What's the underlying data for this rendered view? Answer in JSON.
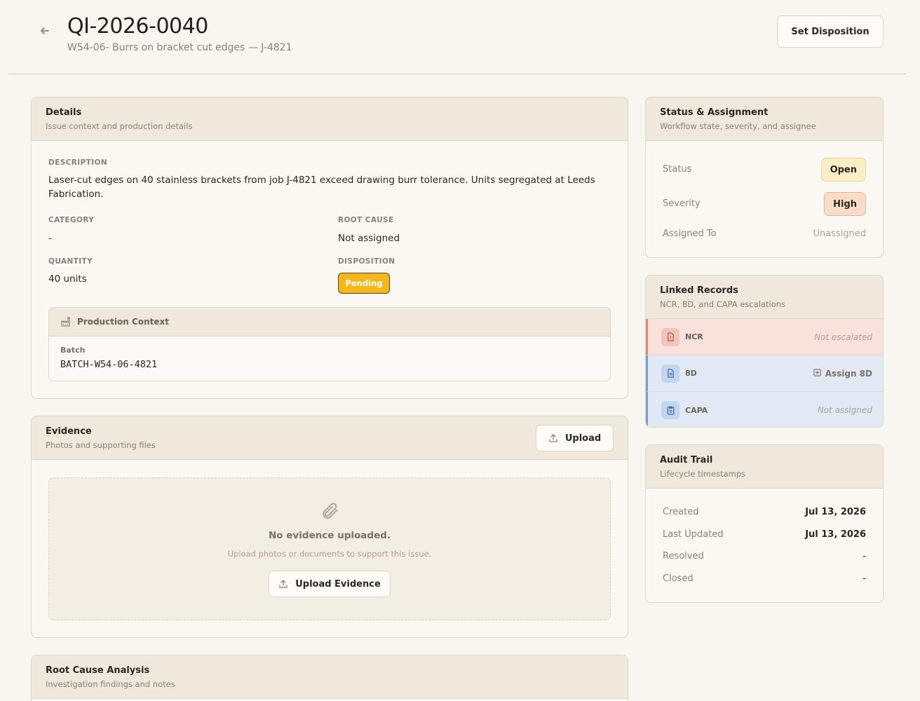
{
  "header": {
    "title": "QI-2026-0040",
    "subtitle": "W54-06- Burrs on bracket cut edges — J-4821",
    "set_disposition_label": "Set Disposition"
  },
  "details": {
    "title": "Details",
    "subtitle": "Issue context and production details",
    "description_label": "Description",
    "description": "Laser-cut edges on 40 stainless brackets from job J-4821 exceed drawing burr tolerance. Units segregated at Leeds Fabrication.",
    "category_label": "Category",
    "category": "-",
    "root_cause_label": "Root Cause",
    "root_cause": "Not assigned",
    "quantity_label": "Quantity",
    "quantity": "40 units",
    "disposition_label": "Disposition",
    "disposition": "Pending",
    "production_context": {
      "title": "Production Context",
      "batch_label": "Batch",
      "batch": "BATCH-W54-06-4821"
    }
  },
  "evidence": {
    "title": "Evidence",
    "subtitle": "Photos and supporting files",
    "upload_label": "Upload",
    "empty_title": "No evidence uploaded.",
    "empty_subtitle": "Upload photos or documents to support this issue.",
    "upload_evidence_label": "Upload Evidence"
  },
  "root_cause_analysis": {
    "title": "Root Cause Analysis",
    "subtitle": "Investigation findings and notes"
  },
  "status": {
    "title": "Status & Assignment",
    "subtitle": "Workflow state, severity, and assignee",
    "status_label": "Status",
    "status": "Open",
    "severity_label": "Severity",
    "severity": "High",
    "assigned_label": "Assigned To",
    "assigned": "Unassigned"
  },
  "linked": {
    "title": "Linked Records",
    "subtitle": "NCR, 8D, and CAPA escalations",
    "ncr_label": "NCR",
    "ncr_state": "Not escalated",
    "d8_label": "8D",
    "d8_action": "Assign 8D",
    "capa_label": "CAPA",
    "capa_state": "Not assigned"
  },
  "audit": {
    "title": "Audit Trail",
    "subtitle": "Lifecycle timestamps",
    "created_label": "Created",
    "created": "Jul 13, 2026",
    "updated_label": "Last Updated",
    "updated": "Jul 13, 2026",
    "resolved_label": "Resolved",
    "resolved": "-",
    "closed_label": "Closed",
    "closed": "-"
  }
}
